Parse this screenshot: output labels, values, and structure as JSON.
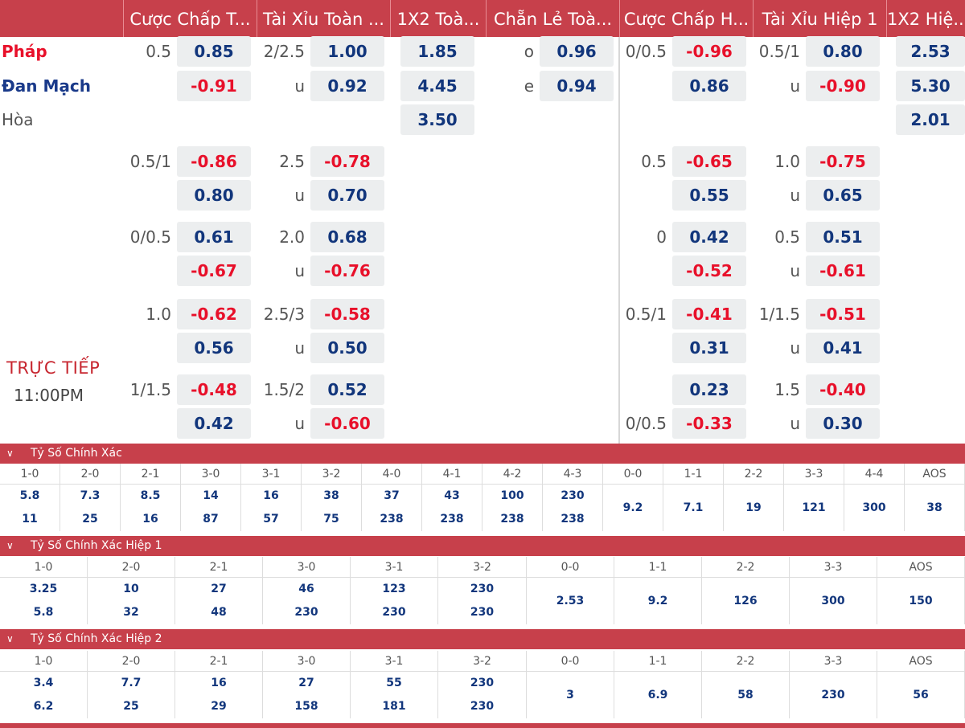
{
  "columns": [
    "Cược Chấp T...",
    "Tài Xỉu Toàn ...",
    "1X2 Toà...",
    "Chẵn Lẻ Toà...",
    "Cược Chấp H...",
    "Tài Xỉu Hiệp 1",
    "1X2 Hiệ..."
  ],
  "teams": {
    "home": "Pháp",
    "away": "Đan Mạch",
    "draw": "Hòa"
  },
  "main": {
    "ft_hdp_line": "0.5",
    "ft_hdp_home": "0.85",
    "ft_hdp_away": "-0.91",
    "ft_ou_line": "2/2.5",
    "ft_ou_over": "1.00",
    "ft_ou_under_lbl": "u",
    "ft_ou_under": "0.92",
    "ft_1x2_home": "1.85",
    "ft_1x2_away": "4.45",
    "ft_1x2_draw": "3.50",
    "oe_odd_lbl": "o",
    "oe_odd": "0.96",
    "oe_even_lbl": "e",
    "oe_even": "0.94",
    "h1_hdp_line": "0/0.5",
    "h1_hdp_home": "-0.96",
    "h1_hdp_away": "0.86",
    "h1_ou_line": "0.5/1",
    "h1_ou_over": "0.80",
    "h1_ou_under_lbl": "u",
    "h1_ou_under": "-0.90",
    "h1_1x2_home": "2.53",
    "h1_1x2_away": "5.30",
    "h1_1x2_draw": "2.01"
  },
  "extra": [
    {
      "ft_hdp_line": "0.5/1",
      "ft_hdp_home": "-0.86",
      "ft_hdp_away": "0.80",
      "ft_ou_line": "2.5",
      "ft_ou_over": "-0.78",
      "ft_ou_under": "0.70",
      "h1_hdp_line": "0.5",
      "h1_hdp_home": "-0.65",
      "h1_hdp_away": "0.55",
      "h1_ou_line": "1.0",
      "h1_ou_over": "-0.75",
      "h1_ou_under": "0.65"
    },
    {
      "ft_hdp_line": "0/0.5",
      "ft_hdp_home": "0.61",
      "ft_hdp_away": "-0.67",
      "ft_ou_line": "2.0",
      "ft_ou_over": "0.68",
      "ft_ou_under": "-0.76",
      "h1_hdp_line": "0",
      "h1_hdp_home": "0.42",
      "h1_hdp_away": "-0.52",
      "h1_ou_line": "0.5",
      "h1_ou_over": "0.51",
      "h1_ou_under": "-0.61"
    },
    {
      "ft_hdp_line": "1.0",
      "ft_hdp_home": "-0.62",
      "ft_hdp_away": "0.56",
      "ft_ou_line": "2.5/3",
      "ft_ou_over": "-0.58",
      "ft_ou_under": "0.50",
      "h1_hdp_line": "0.5/1",
      "h1_hdp_home": "-0.41",
      "h1_hdp_away": "0.31",
      "h1_ou_line": "1/1.5",
      "h1_ou_over": "-0.51",
      "h1_ou_under": "0.41"
    },
    {
      "ft_hdp_line": "1/1.5",
      "ft_hdp_home": "-0.48",
      "ft_hdp_away": "0.42",
      "ft_ou_line": "1.5/2",
      "ft_ou_over": "0.52",
      "ft_ou_under": "-0.60",
      "h1_hdp_line": "",
      "h1_hdp_home": "0.23",
      "h1_hdp_away": "-0.33",
      "h1_hdp_line2": "0/0.5",
      "h1_ou_line": "1.5",
      "h1_ou_over": "-0.40",
      "h1_ou_under": "0.30"
    }
  ],
  "under_label": "u",
  "status": {
    "live": "TRỰC TIẾP",
    "time": "11:00PM"
  },
  "correct_score": {
    "title": "Tỷ Số Chính Xác",
    "headers": [
      "1-0",
      "2-0",
      "2-1",
      "3-0",
      "3-1",
      "3-2",
      "4-0",
      "4-1",
      "4-2",
      "4-3",
      "0-0",
      "1-1",
      "2-2",
      "3-3",
      "4-4",
      "AOS"
    ],
    "home": [
      "5.8",
      "7.3",
      "8.5",
      "14",
      "16",
      "38",
      "37",
      "43",
      "100",
      "230",
      "9.2",
      "7.1",
      "19",
      "121",
      "300",
      "38"
    ],
    "away": [
      "11",
      "25",
      "16",
      "87",
      "57",
      "75",
      "238",
      "238",
      "238",
      "238",
      "",
      "",
      "",
      "",
      "",
      ""
    ]
  },
  "correct_score_h1": {
    "title": "Tỷ Số Chính Xác Hiệp 1",
    "headers": [
      "1-0",
      "2-0",
      "2-1",
      "3-0",
      "3-1",
      "3-2",
      "0-0",
      "1-1",
      "2-2",
      "3-3",
      "AOS"
    ],
    "home": [
      "3.25",
      "10",
      "27",
      "46",
      "123",
      "230",
      "2.53",
      "9.2",
      "126",
      "300",
      "150"
    ],
    "away": [
      "5.8",
      "32",
      "48",
      "230",
      "230",
      "230",
      "",
      "",
      "",
      "",
      ""
    ]
  },
  "correct_score_h2": {
    "title": "Tỷ Số Chính Xác Hiệp 2",
    "headers": [
      "1-0",
      "2-0",
      "2-1",
      "3-0",
      "3-1",
      "3-2",
      "0-0",
      "1-1",
      "2-2",
      "3-3",
      "AOS"
    ],
    "home": [
      "3.4",
      "7.7",
      "16",
      "27",
      "55",
      "230",
      "3",
      "6.9",
      "58",
      "230",
      "56"
    ],
    "away": [
      "6.2",
      "25",
      "29",
      "158",
      "181",
      "230",
      "",
      "",
      "",
      "",
      ""
    ]
  },
  "colors": {
    "header_bg": "#c7404b",
    "odd_blue": "#12367c",
    "odd_red": "#e8102a",
    "cell_bg": "#eceeef"
  }
}
